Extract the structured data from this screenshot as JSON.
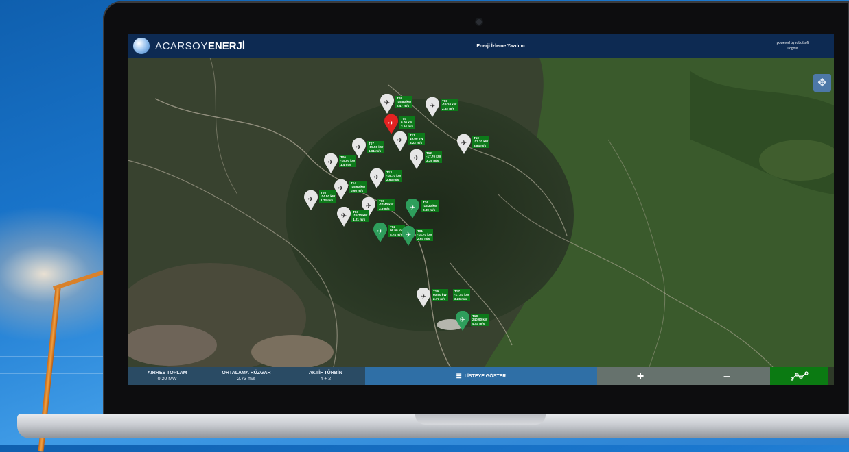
{
  "header": {
    "brand_primary": "ACARSOY",
    "brand_secondary": "ENERJİ",
    "app_title": "Enerji İzleme Yazılımı",
    "powered_by": "powered by robo/soft",
    "logout_label": "Logout"
  },
  "colors": {
    "header_bg": "#0d2a52",
    "label_green": "#0d7a1a",
    "alert_red": "#e32222",
    "ok_green": "#2e9e5c",
    "idle_white": "#e6e6e6",
    "list_button_bg": "#2f6fa6"
  },
  "map": {
    "compass_icon": "compass-icon",
    "turbines": [
      {
        "id": "T09",
        "power": "-15.80 kW",
        "wind": "2.47 m/s",
        "status": "idle"
      },
      {
        "id": "T08",
        "power": "-16.10 kW",
        "wind": "2.92 m/s",
        "status": "idle"
      },
      {
        "id": "T04",
        "power": "0.00 kW",
        "wind": "3.64 m/s",
        "status": "alert"
      },
      {
        "id": "T11",
        "power": "19.00 kW",
        "wind": "3.22 m/s",
        "status": "idle"
      },
      {
        "id": "T10",
        "power": "-17.30 kW",
        "wind": "3.84 m/s",
        "status": "idle"
      },
      {
        "id": "T07",
        "power": "-15.50 kW",
        "wind": "1.61 m/s",
        "status": "idle"
      },
      {
        "id": "T12",
        "power": "-17.70 kW",
        "wind": "3.39 m/s",
        "status": "idle"
      },
      {
        "id": "T06",
        "power": "-15.00 kW",
        "wind": "1.4 m/s",
        "status": "idle"
      },
      {
        "id": "T13",
        "power": "-15.70 kW",
        "wind": "2.63 m/s",
        "status": "idle"
      },
      {
        "id": "T14",
        "power": "-15.60 kW",
        "wind": "0.95 m/s",
        "status": "idle"
      },
      {
        "id": "T05",
        "power": "-14.50 kW",
        "wind": "1.74 m/s",
        "status": "idle"
      },
      {
        "id": "T15",
        "power": "-14.40 kW",
        "wind": "3.5 m/s",
        "status": "idle"
      },
      {
        "id": "T16",
        "power": "-15.30 kW",
        "wind": "2.39 m/s",
        "status": "ok"
      },
      {
        "id": "T03",
        "power": "-15.70 kW",
        "wind": "1.21 m/s",
        "status": "idle"
      },
      {
        "id": "T02",
        "power": "96.90 kW",
        "wind": "5.74 m/s",
        "status": "ok"
      },
      {
        "id": "T01",
        "power": "-14.70 kW",
        "wind": "2.64 m/s",
        "status": "ok"
      },
      {
        "id": "T19",
        "power": "60.50 kW",
        "wind": "2.77 m/s",
        "status": "idle"
      },
      {
        "id": "T17",
        "power": "-17.40 kW",
        "wind": "3.26 m/s",
        "status": "idle"
      },
      {
        "id": "T18",
        "power": "240.90 kW",
        "wind": "4.44 m/s",
        "status": "ok"
      }
    ]
  },
  "footer": {
    "stats": [
      {
        "label": "AIRRES TOPLAM",
        "value": "0.20 MW"
      },
      {
        "label": "ORTALAMA RÜZGAR",
        "value": "2.73 m/s"
      },
      {
        "label": "AKTİF TÜRBİN",
        "value": "4 + 2"
      }
    ],
    "list_button_label": "LİSTEYE GÖSTER",
    "list_icon": "list-icon",
    "zoom_in_label": "+",
    "zoom_out_label": "–",
    "graph_icon": "graph-icon"
  }
}
